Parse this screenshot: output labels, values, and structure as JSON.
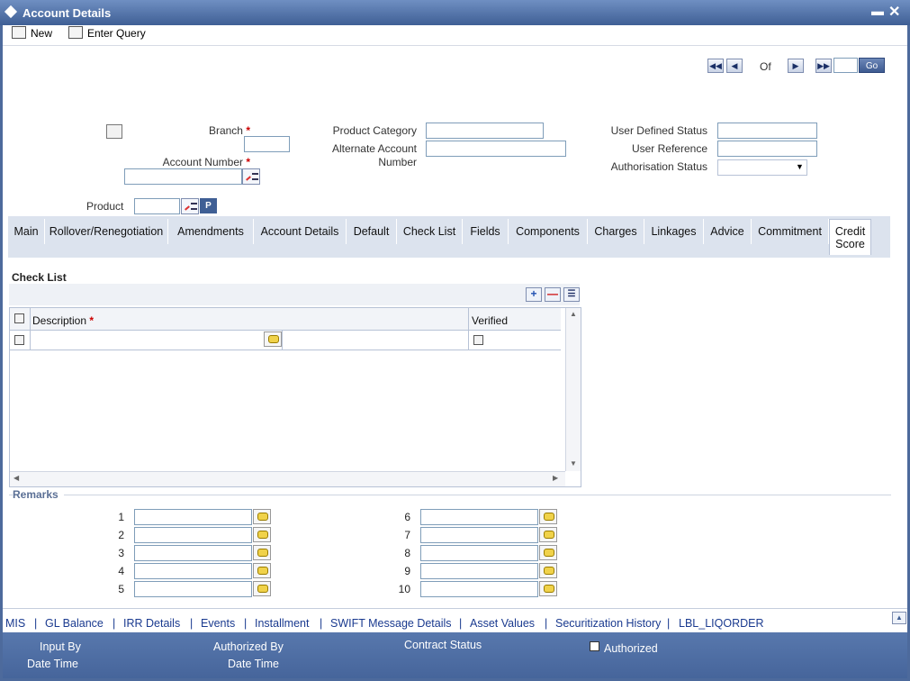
{
  "window": {
    "title": "Account Details"
  },
  "toolbar": {
    "new_label": "New",
    "enter_query_label": "Enter Query"
  },
  "nav": {
    "of_label": "Of",
    "go_label": "Go"
  },
  "form": {
    "branch_label": "Branch",
    "account_number_label": "Account Number",
    "product_label": "Product",
    "product_p_label": "P",
    "product_category_label": "Product Category",
    "alternate_account_label_1": "Alternate Account",
    "alternate_account_label_2": "Number",
    "user_defined_status_label": "User Defined Status",
    "user_reference_label": "User Reference",
    "authorisation_status_label": "Authorisation Status",
    "required_mark": "*"
  },
  "tabs": [
    {
      "label": "Main"
    },
    {
      "label": "Rollover/Renegotiation"
    },
    {
      "label": "Amendments"
    },
    {
      "label": "Account Details"
    },
    {
      "label": "Default"
    },
    {
      "label": "Check List"
    },
    {
      "label": "Fields"
    },
    {
      "label": "Components"
    },
    {
      "label": "Charges"
    },
    {
      "label": "Linkages"
    },
    {
      "label": "Advice"
    },
    {
      "label": "Commitment"
    },
    {
      "label_1": "Credit",
      "label_2": "Score"
    }
  ],
  "checklist": {
    "title": "Check List",
    "col_description": "Description",
    "col_verified": "Verified",
    "required_mark": "*"
  },
  "remarks": {
    "title": "Remarks",
    "left": [
      "1",
      "2",
      "3",
      "4",
      "5"
    ],
    "right": [
      "6",
      "7",
      "8",
      "9",
      "10"
    ]
  },
  "links": [
    "MIS",
    "GL Balance",
    "IRR Details",
    "Events",
    "Installment",
    "SWIFT Message Details",
    "Asset Values",
    "Securitization History",
    "LBL_LIQORDER"
  ],
  "links_separator": "|",
  "footer": {
    "input_by": "Input By",
    "date_time_1": "Date Time",
    "authorized_by": "Authorized By",
    "date_time_2": "Date Time",
    "contract_status": "Contract Status",
    "authorized": "Authorized"
  }
}
